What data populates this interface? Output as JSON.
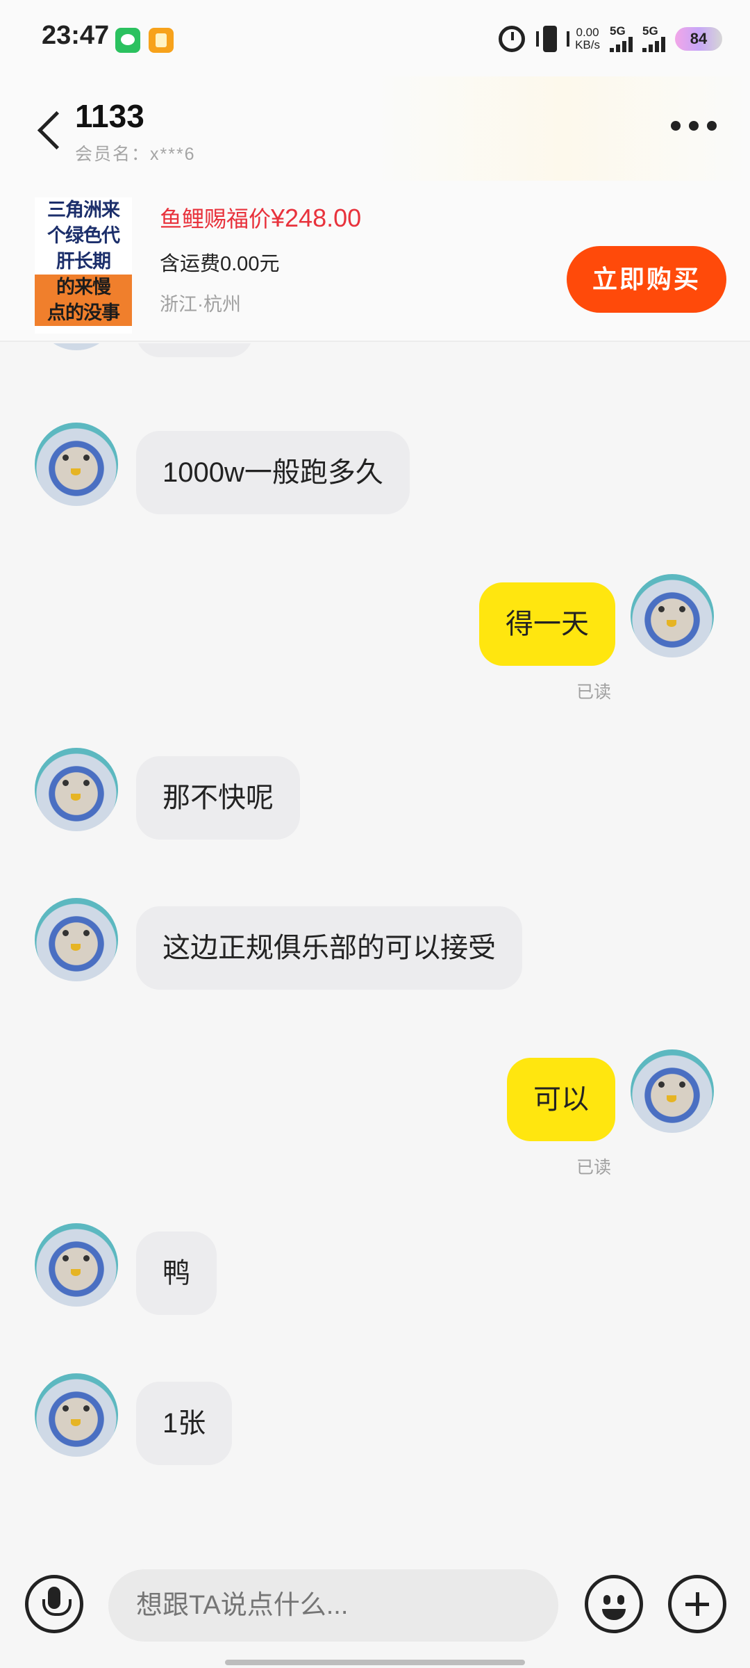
{
  "status_bar": {
    "time": "23:47",
    "net_speed_value": "0.00",
    "net_speed_unit": "KB/s",
    "sim1_label": "5G",
    "sim2_label": "5G",
    "battery": "84",
    "icons": [
      "wechat-icon",
      "notes-icon",
      "alarm-icon",
      "vibrate-icon",
      "signal-icon",
      "battery-icon"
    ]
  },
  "header": {
    "title": "1133",
    "member_name": "会员名：x***6"
  },
  "product": {
    "thumb_lines": [
      "三角洲来",
      "个绿色代",
      "肝长期",
      "的来慢",
      "点的没事"
    ],
    "promo_label": "鱼鲤赐福价",
    "price": "¥248.00",
    "shipping": "含运费0.00元",
    "location": "浙江·杭州",
    "buy_label": "立即购买",
    "colors": {
      "price": "#e8323c",
      "buy_button": "#ff4a0a"
    }
  },
  "messages": [
    {
      "side": "in",
      "text": ""
    },
    {
      "side": "in",
      "text": "1000w一般跑多久"
    },
    {
      "side": "out",
      "text": "得一天",
      "status": "已读"
    },
    {
      "side": "in",
      "text": "那不快呢"
    },
    {
      "side": "in",
      "text": "这边正规俱乐部的可以接受"
    },
    {
      "side": "out",
      "text": "可以",
      "status": "已读"
    },
    {
      "side": "in",
      "text": "鸭"
    },
    {
      "side": "in",
      "text": "1张"
    }
  ],
  "input_bar": {
    "placeholder": "想跟TA说点什么...",
    "icons": [
      "microphone-icon",
      "emoji-icon",
      "add-icon"
    ]
  },
  "colors": {
    "outgoing_bubble": "#ffe60f",
    "incoming_bubble": "#ececee"
  }
}
